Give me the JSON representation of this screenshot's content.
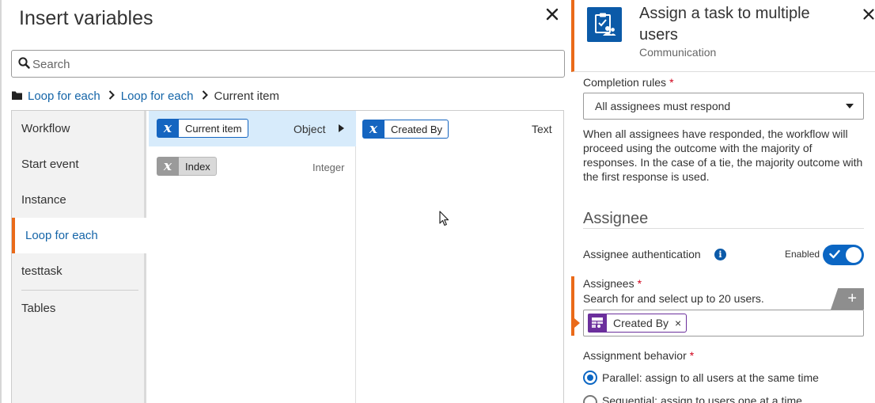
{
  "dialog": {
    "title": "Insert variables",
    "search_placeholder": "Search",
    "breadcrumb": [
      "Loop for each",
      "Loop for each",
      "Current item"
    ],
    "categories": [
      "Workflow",
      "Start event",
      "Instance",
      "Loop for each",
      "testtask",
      "Tables"
    ],
    "active_category": "Loop for each",
    "variables": [
      {
        "label": "Current item",
        "type": "Object",
        "selected": true
      },
      {
        "label": "Index",
        "type": "Integer",
        "selected": false
      }
    ],
    "detail": [
      {
        "label": "Created By",
        "type": "Text"
      }
    ],
    "icons": [
      "search-icon",
      "folder-icon",
      "close-icon",
      "variable-icon",
      "chevron-right-icon"
    ]
  },
  "side": {
    "title": "Assign a task to multiple users",
    "subtitle": "Communication",
    "completion_label": "Completion rules",
    "completion_value": "All assignees must respond",
    "completion_help": "When all assignees have responded, the workflow will proceed using the outcome with the majority of responses. In the case of a tie, the majority outcome with the first response is used.",
    "section_title": "Assignee",
    "auth_label": "Assignee authentication",
    "auth_toggle_label": "Enabled",
    "auth_enabled": true,
    "assignees_label": "Assignees",
    "assignees_help": "Search for and select up to 20 users.",
    "add_symbol": "+",
    "assignees": [
      {
        "label": "Created By"
      }
    ],
    "behavior_label": "Assignment behavior",
    "behavior_options": [
      {
        "label": "Parallel: assign to all users at the same time",
        "selected": true
      },
      {
        "label": "Sequential: assign to users one at a time",
        "selected": false
      }
    ],
    "required_mark": "*",
    "remove_symbol": "×",
    "colors": {
      "accent": "#ea6a19",
      "primary": "#0b66c3",
      "variable": "#1565c0",
      "user_tag": "#6b2f9c"
    }
  }
}
